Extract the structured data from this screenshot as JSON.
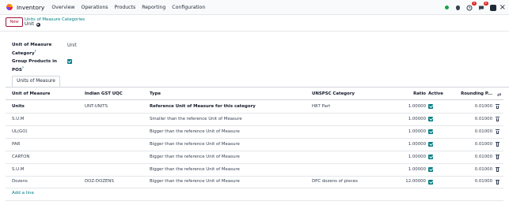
{
  "navbar": {
    "app_name": "Inventory",
    "menu": [
      "Overview",
      "Operations",
      "Products",
      "Reporting",
      "Configuration"
    ],
    "badges": {
      "activity": "3",
      "messages": "8"
    }
  },
  "control_panel": {
    "new_label": "New",
    "breadcrumb": "Units of Measure Categories",
    "record_title": "Unit"
  },
  "form": {
    "uom_category_label": "Unit of Measure Category",
    "uom_category_help": "?",
    "uom_category_value": "Unit",
    "group_pos_label": "Group Products in POS",
    "group_pos_help": "?",
    "group_pos_checked": true
  },
  "tabs": [
    "Units of Measure"
  ],
  "table": {
    "columns": [
      "Unit of Measure",
      "Indian GST UQC",
      "Type",
      "UNSPSC Category",
      "Ratio",
      "Active",
      "Rounding P..."
    ],
    "rows": [
      {
        "uom": "Units",
        "gst": "UNT-UNITS",
        "type": "Reference Unit of Measure for this category",
        "unspsc": "H87 Part",
        "ratio": "1.00000",
        "active": true,
        "rounding": "0.01000",
        "bold": true
      },
      {
        "uom": "S.U.M",
        "gst": "",
        "type": "Smaller than the reference Unit of Measure",
        "unspsc": "",
        "ratio": "1.00000",
        "active": true,
        "rounding": "0.01000",
        "bold": false
      },
      {
        "uom": "UL(GO)",
        "gst": "",
        "type": "Bigger than the reference Unit of Measure",
        "unspsc": "",
        "ratio": "1.00000",
        "active": true,
        "rounding": "0.01000",
        "bold": false
      },
      {
        "uom": "PAR",
        "gst": "",
        "type": "Bigger than the reference Unit of Measure",
        "unspsc": "",
        "ratio": "1.00000",
        "active": true,
        "rounding": "0.01000",
        "bold": false
      },
      {
        "uom": "CARTON",
        "gst": "",
        "type": "Bigger than the reference Unit of Measure",
        "unspsc": "",
        "ratio": "1.00000",
        "active": true,
        "rounding": "0.01000",
        "bold": false
      },
      {
        "uom": "S.U.M",
        "gst": "",
        "type": "Bigger than the reference Unit of Measure",
        "unspsc": "",
        "ratio": "1.00000",
        "active": true,
        "rounding": "0.01000",
        "bold": false
      },
      {
        "uom": "Dozens",
        "gst": "DOZ-DOZENS",
        "type": "Bigger than the reference Unit of Measure",
        "unspsc": "DPC dozens of pieces",
        "ratio": "12.00000",
        "active": true,
        "rounding": "0.01000",
        "bold": false
      }
    ],
    "add_line": "Add a line"
  },
  "colors": {
    "brand": "#9f1239",
    "accent": "#017e84",
    "status_online": "#16a34a",
    "badge": "#dc2626"
  },
  "icons": [
    "app-logo-icon",
    "online-status-icon",
    "bug-icon",
    "clock-icon",
    "chat-icon",
    "avatar",
    "close-icon",
    "gear-icon",
    "trash-icon",
    "optional-columns-icon"
  ]
}
